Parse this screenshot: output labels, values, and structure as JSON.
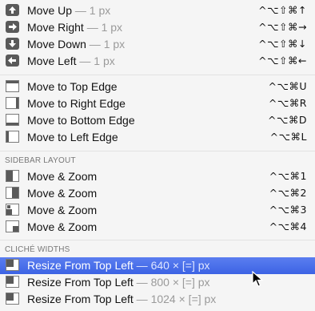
{
  "move_items": [
    {
      "label": "Move Up",
      "dim": " — 1 px",
      "shortcut": "^⌥⇧⌘↑"
    },
    {
      "label": "Move Right",
      "dim": " — 1 px",
      "shortcut": "^⌥⇧⌘→"
    },
    {
      "label": "Move Down",
      "dim": " — 1 px",
      "shortcut": "^⌥⇧⌘↓"
    },
    {
      "label": "Move Left",
      "dim": " — 1 px",
      "shortcut": "^⌥⇧⌘←"
    }
  ],
  "edge_items": [
    {
      "label": "Move to Top Edge",
      "shortcut": "^⌥⌘U"
    },
    {
      "label": "Move to Right Edge",
      "shortcut": "^⌥⌘R"
    },
    {
      "label": "Move to Bottom Edge",
      "shortcut": "^⌥⌘D"
    },
    {
      "label": "Move to Left Edge",
      "shortcut": "^⌥⌘L"
    }
  ],
  "sidebar_layout": {
    "header": "SIDEBAR LAYOUT",
    "items": [
      {
        "label": "Move & Zoom",
        "shortcut": "^⌥⌘1"
      },
      {
        "label": "Move & Zoom",
        "shortcut": "^⌥⌘2"
      },
      {
        "label": "Move & Zoom",
        "shortcut": "^⌥⌘3"
      },
      {
        "label": "Move & Zoom",
        "shortcut": "^⌥⌘4"
      }
    ]
  },
  "cliche_widths": {
    "header": "CLICHÉ WIDTHS",
    "items": [
      {
        "label": "Resize From Top Left",
        "dim": " — 640 × [=] px",
        "selected": true
      },
      {
        "label": "Resize From Top Left",
        "dim": " — 800 × [=] px",
        "selected": false
      },
      {
        "label": "Resize From Top Left",
        "dim": " — 1024 × [=] px",
        "selected": false
      }
    ]
  },
  "icons": {
    "move": [
      "arrow-up-icon",
      "arrow-right-icon",
      "arrow-down-icon",
      "arrow-left-icon"
    ],
    "edge": [
      "top-edge-icon",
      "right-edge-icon",
      "bottom-edge-icon",
      "left-edge-icon"
    ],
    "sidebar": [
      "sidebar-top-left-icon",
      "sidebar-top-right-icon",
      "sidebar-bottom-left-icon",
      "sidebar-bottom-right-icon"
    ],
    "resize": "resize-top-left-icon"
  },
  "colors": {
    "selection": "#3c63e4",
    "icon_dark": "#5a5a5a",
    "dim_text": "#9a9a9a"
  }
}
